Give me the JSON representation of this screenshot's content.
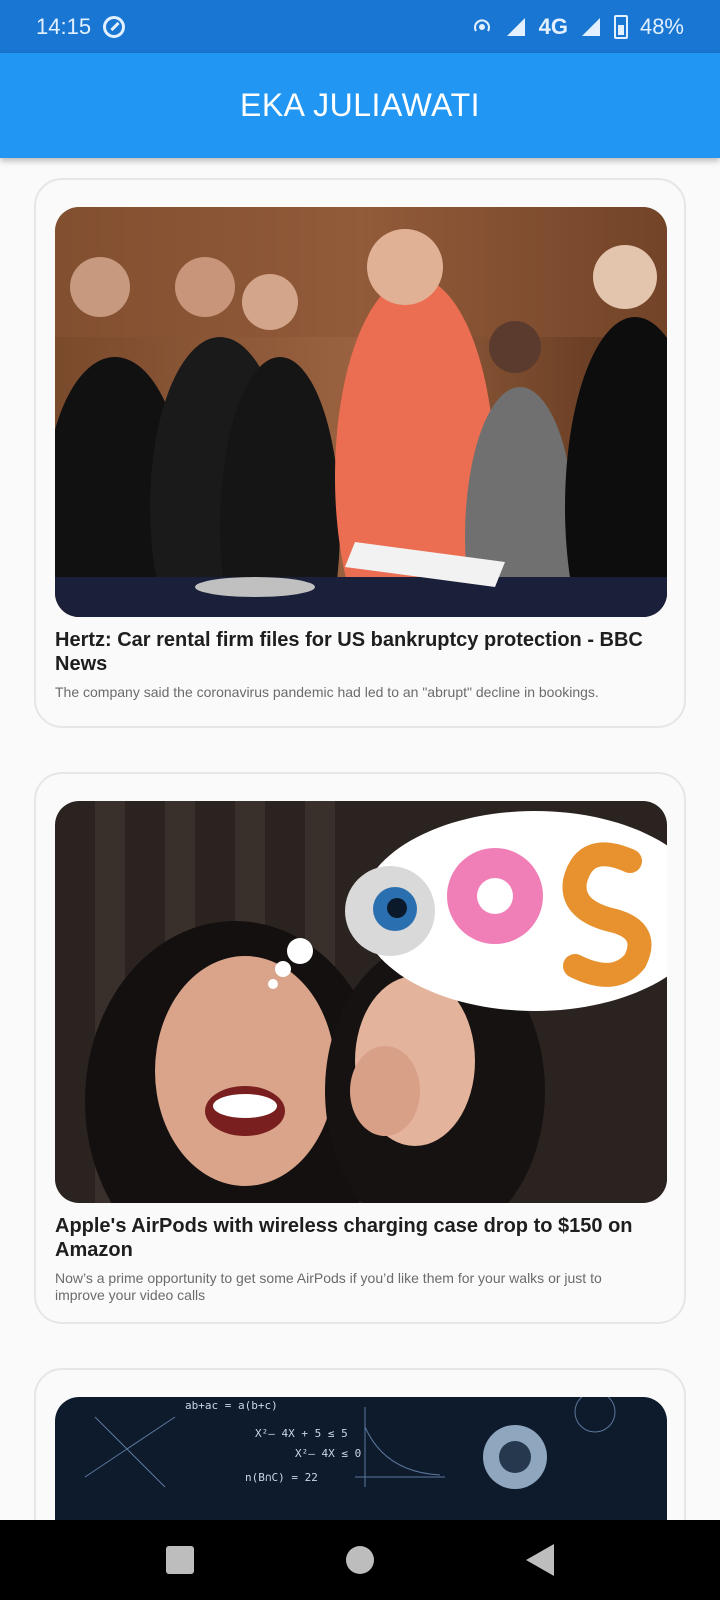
{
  "status_bar": {
    "time": "14:15",
    "network": "4G",
    "battery": "48%"
  },
  "app_bar": {
    "title": "EKA JULIAWATI"
  },
  "articles": [
    {
      "title": "Hertz: Car rental firm files for US bankruptcy protection - BBC News",
      "description": "The company said the coronavirus pandemic had led to an \"abrupt\" decline in bookings.",
      "image": "politicians-signing-photo"
    },
    {
      "title": "Apple's AirPods with wireless charging case drop to $150 on Amazon",
      "description": "Now’s a prime opportunity to get some AirPods if you’d like them for your walks or just to improve your video calls",
      "image": "women-whispering-eye-donut-s-photo"
    },
    {
      "title": "",
      "description": "",
      "image": "math-formulas-robot-photo"
    }
  ],
  "nav_bar": {
    "icons": [
      "recents-icon",
      "home-icon",
      "back-icon"
    ]
  },
  "colors": {
    "status_bar": "#1976d2",
    "app_bar": "#2196f3",
    "background": "#fafafa",
    "nav_bar": "#000000"
  }
}
